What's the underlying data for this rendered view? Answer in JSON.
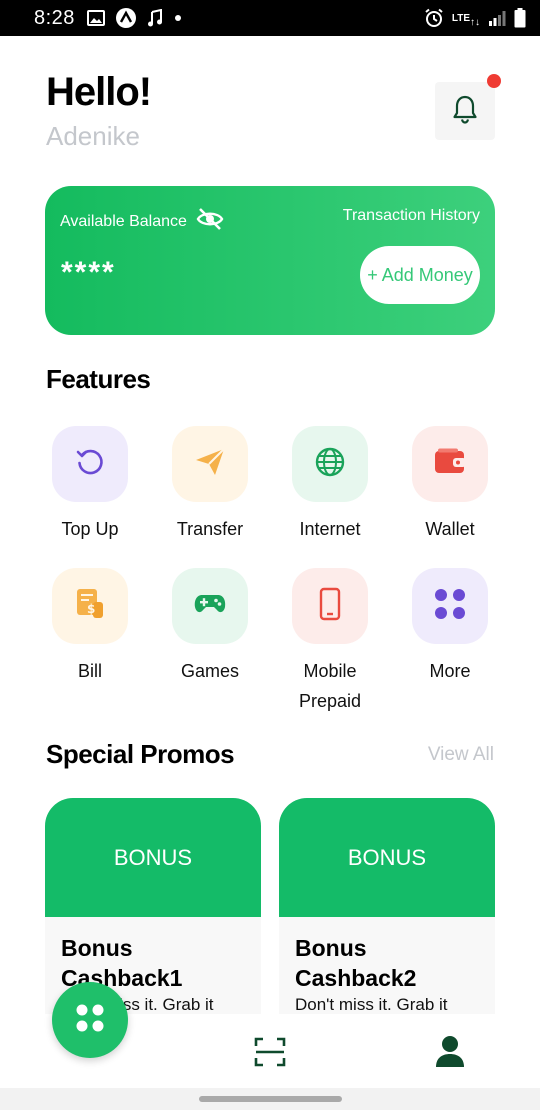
{
  "status_bar": {
    "time": "8:28",
    "left_icons": [
      "image-icon",
      "app-icon",
      "music-icon",
      "dot-icon"
    ],
    "network": "LTE",
    "right_icons": [
      "alarm-icon",
      "lte-icon",
      "signal-icon",
      "battery-icon"
    ]
  },
  "header": {
    "greeting": "Hello!",
    "username": "Adenike",
    "notification_icon": "bell-icon",
    "has_unread": true
  },
  "balance_card": {
    "label": "Available Balance",
    "visibility_icon": "eye-off-icon",
    "transaction_history": "Transaction History",
    "balance": "****",
    "add_money": "+ Add Money"
  },
  "features": {
    "title": "Features",
    "items": [
      {
        "label": "Top Up",
        "icon": "refresh-icon",
        "bg": "#efebfc",
        "color": "#6a4ad4"
      },
      {
        "label": "Transfer",
        "icon": "send-icon",
        "bg": "#fff5e5",
        "color": "#f5b14a"
      },
      {
        "label": "Internet",
        "icon": "globe-icon",
        "bg": "#e7f7ee",
        "color": "#1aa35a"
      },
      {
        "label": "Wallet",
        "icon": "wallet-icon",
        "bg": "#fdecea",
        "color": "#e94a3f"
      },
      {
        "label": "Bill",
        "icon": "bill-icon",
        "bg": "#fff5e5",
        "color": "#f5b14a"
      },
      {
        "label": "Games",
        "icon": "gamepad-icon",
        "bg": "#e7f7ee",
        "color": "#1aa35a"
      },
      {
        "label": "Mobile Prepaid",
        "icon": "mobile-icon",
        "bg": "#fdecea",
        "color": "#e94a3f"
      },
      {
        "label": "More",
        "icon": "grid-dots-icon",
        "bg": "#efebfc",
        "color": "#6a4ad4"
      }
    ]
  },
  "promos": {
    "title": "Special Promos",
    "view_all": "View All",
    "items": [
      {
        "banner": "BONUS",
        "title": "Bonus Cashback1",
        "description": "Don't miss it. Grab it"
      },
      {
        "banner": "BONUS",
        "title": "Bonus Cashback2",
        "description": "Don't miss it. Grab it"
      }
    ]
  },
  "bottom_nav": {
    "items": [
      "home-grid-icon",
      "scan-icon",
      "profile-icon"
    ]
  },
  "colors": {
    "accent": "#1fbf6a",
    "card_start": "#14bb5e",
    "card_end": "#3dd07c",
    "dark_green": "#0f4a2d",
    "muted": "#c4c7cc",
    "badge": "#ef3b33"
  }
}
